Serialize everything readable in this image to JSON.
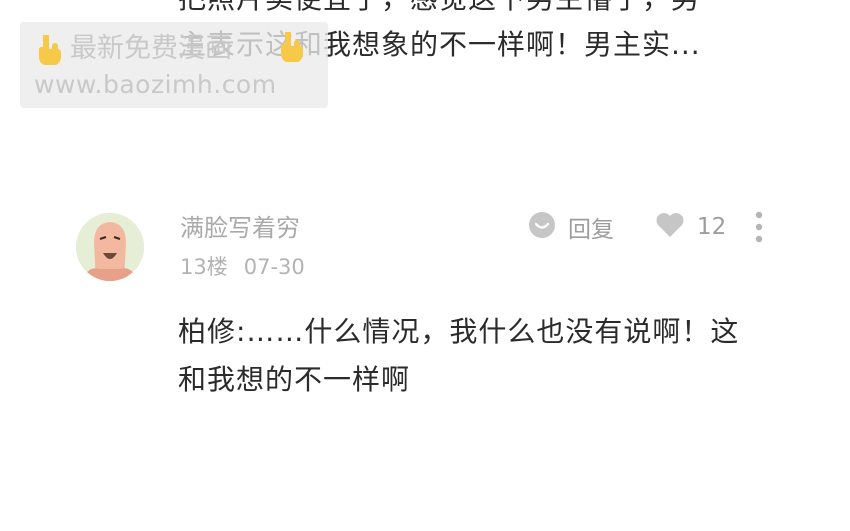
{
  "previous_comment": {
    "lines": [
      "把照片卖便宜了，感觉这下男主懵了，男",
      "主表示这和我想象的不一样啊！男主实..."
    ]
  },
  "watermark": {
    "text": "最新免费漫画",
    "url": "www.baozimh.com"
  },
  "comment": {
    "username": "满脸写着穷",
    "floor": "13楼",
    "date": "07-30",
    "reply_label": "回复",
    "like_count": "12",
    "body_lines": [
      "柏修:……什么情况，我什么也没有说啊！这",
      "和我想的不一样啊"
    ]
  },
  "colors": {
    "text_primary": "#2b2b2b",
    "text_secondary": "#a9a9a9",
    "icon": "#c4c4c4"
  }
}
